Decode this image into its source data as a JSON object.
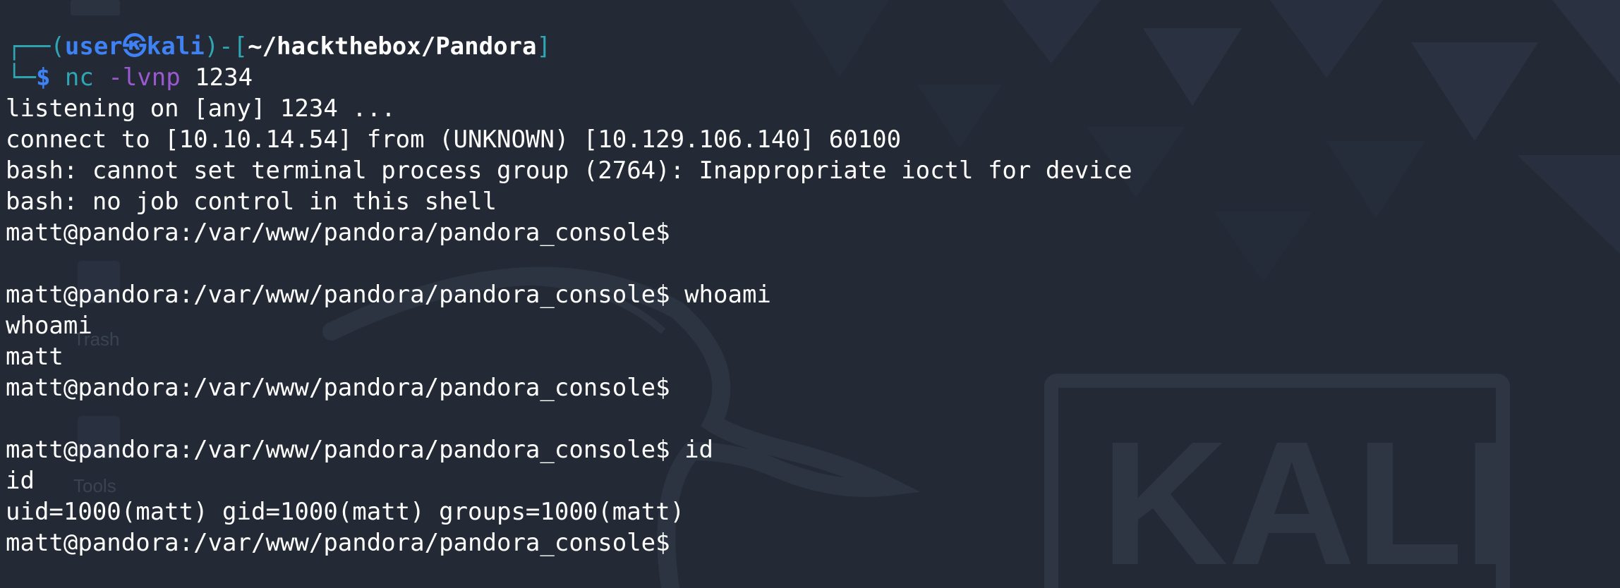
{
  "prompt": {
    "corner_top": "┌──(",
    "user": "user",
    "at_symbol": "㉿",
    "host": "kali",
    "sep": ")-[",
    "cwd": "~/hackthebox/Pandora",
    "close": "]",
    "corner_bottom": "└─",
    "dollar": "$",
    "command": "nc",
    "flags": "-lvnp",
    "port": "1234"
  },
  "output_lines": [
    "listening on [any] 1234 ...",
    "connect to [10.10.14.54] from (UNKNOWN) [10.129.106.140] 60100",
    "bash: cannot set terminal process group (2764): Inappropriate ioctl for device",
    "bash: no job control in this shell",
    "matt@pandora:/var/www/pandora/pandora_console$ ",
    "",
    "matt@pandora:/var/www/pandora/pandora_console$ whoami",
    "whoami",
    "matt",
    "matt@pandora:/var/www/pandora/pandora_console$ ",
    "",
    "matt@pandora:/var/www/pandora/pandora_console$ id",
    "id",
    "uid=1000(matt) gid=1000(matt) groups=1000(matt)",
    "matt@pandora:/var/www/pandora/pandora_console$ "
  ],
  "wallpaper": {
    "brand_text": "KALI",
    "desktop_icon_labels": [
      "Trash",
      "Tools"
    ]
  },
  "colors": {
    "background": "#232a35",
    "prompt_border": "#2fa6b3",
    "user_host": "#3f82f5",
    "flag": "#9b59d0",
    "text": "#ffffff"
  }
}
